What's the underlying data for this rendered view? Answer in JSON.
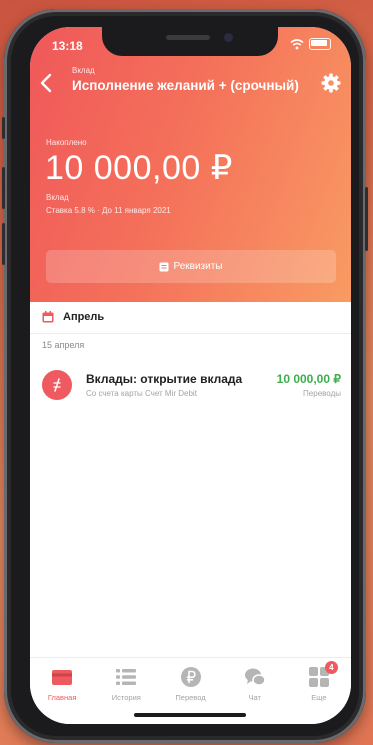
{
  "status_bar": {
    "time": "13:18"
  },
  "header": {
    "kind": "Вклад",
    "title": "Исполнение желаний + (срочный)"
  },
  "summary": {
    "accumulated_label": "Накоплено",
    "amount": "10 000,00 ₽",
    "deposit_label": "Вклад",
    "rate_text": "Ставка 5.8 % · До 11 января 2021",
    "requisites_label": "Реквизиты"
  },
  "history": {
    "month": "Апрель",
    "date": "15 апреля",
    "transactions": [
      {
        "title": "Вклады: открытие вклада",
        "subtitle": "Со счета карты Счет Mir Debit",
        "amount": "10 000,00 ₽",
        "category": "Переводы"
      }
    ]
  },
  "tabbar": {
    "items": [
      {
        "label": "Главная",
        "icon": "card-icon",
        "active": true
      },
      {
        "label": "История",
        "icon": "list-icon"
      },
      {
        "label": "Перевод",
        "icon": "ruble-icon"
      },
      {
        "label": "Чат",
        "icon": "chat-icon"
      },
      {
        "label": "Еще",
        "icon": "grid-icon",
        "badge": "4"
      }
    ]
  },
  "colors": {
    "accent": "#ee5a5f",
    "hero_start": "#f0585a",
    "hero_end": "#f99b63",
    "positive_amount": "#3dae4b"
  }
}
